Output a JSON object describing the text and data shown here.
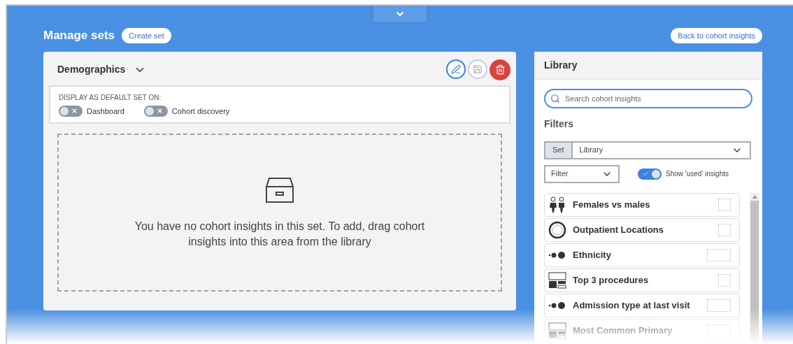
{
  "header": {
    "title": "Manage sets",
    "create_button": "Create set",
    "back_button": "Back to cohort insights"
  },
  "set_card": {
    "name": "Demographics",
    "default_label": "DISPLAY AS DEFAULT SET ON:",
    "toggles": [
      {
        "label": "Dashboard",
        "on": false
      },
      {
        "label": "Cohort discovery",
        "on": false
      }
    ],
    "empty_message": "You have no cohort insights in this set. To add, drag cohort insights into this area from the library"
  },
  "library": {
    "title": "Library",
    "search": {
      "placeholder": "Search cohort insights"
    },
    "filters_title": "Filters",
    "set_label": "Set",
    "set_value": "Library",
    "filter_value": "Filter",
    "show_used": {
      "label": "Show 'used' insights",
      "on": true
    },
    "items": [
      {
        "label": "Females vs males",
        "kind": "people",
        "wide": false
      },
      {
        "label": "Outpatient Locations",
        "kind": "donut",
        "wide": false
      },
      {
        "label": "Ethnicity",
        "kind": "dots",
        "wide": true
      },
      {
        "label": "Top 3 procedures",
        "kind": "table",
        "wide": false
      },
      {
        "label": "Admission type at last visit",
        "kind": "dots",
        "wide": true
      },
      {
        "label": "Most Common Primary",
        "kind": "table",
        "wide": true
      }
    ]
  }
}
